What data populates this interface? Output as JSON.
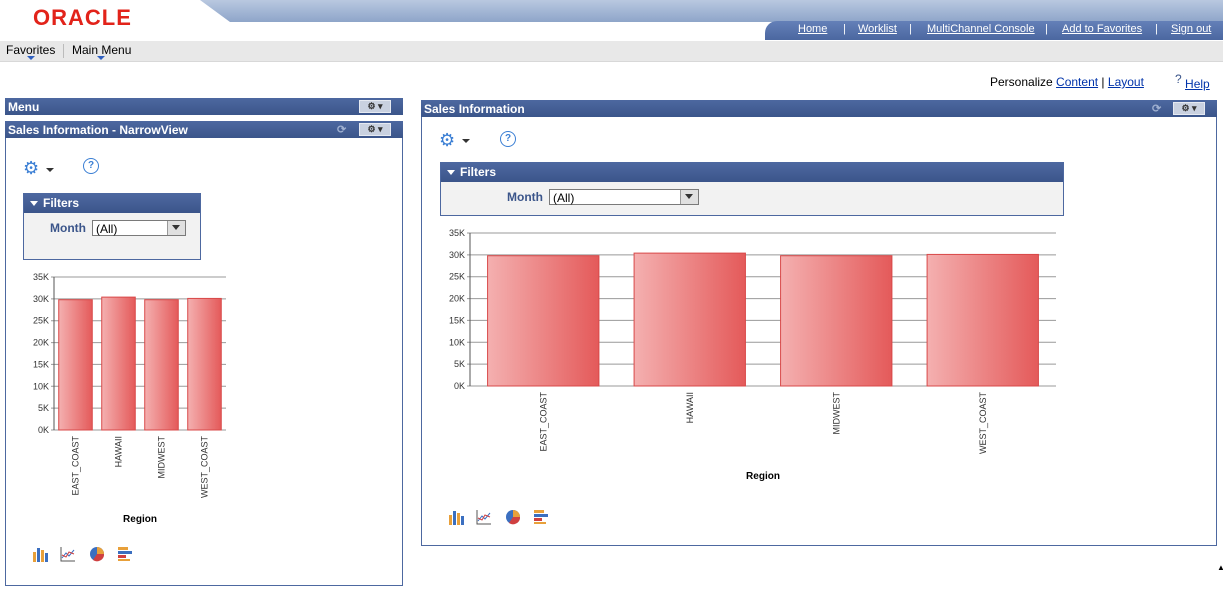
{
  "header": {
    "logo": "ORACLE",
    "links": [
      "Home",
      "Worklist",
      "MultiChannel Console",
      "Add to Favorites",
      "Sign out"
    ]
  },
  "menubar": {
    "favorites": "Favorites",
    "main_menu": "Main Menu"
  },
  "personalize": {
    "label": "Personalize",
    "content": "Content",
    "separator": "|",
    "layout": "Layout"
  },
  "help": {
    "symbol": "?",
    "label": "Help"
  },
  "left": {
    "menu_title": "Menu",
    "panel_title": "Sales Information - NarrowView",
    "filters": {
      "title": "Filters",
      "month_label": "Month",
      "month_value": "(All)"
    }
  },
  "right": {
    "panel_title": "Sales Information",
    "filters": {
      "title": "Filters",
      "month_label": "Month",
      "month_value": "(All)"
    }
  },
  "chart_data": [
    {
      "type": "bar",
      "categories": [
        "EAST_COAST",
        "HAWAII",
        "MIDWEST",
        "WEST_COAST"
      ],
      "values": [
        29800,
        30400,
        29800,
        30100
      ],
      "xlabel": "Region",
      "ylabel": "",
      "ylim": [
        0,
        35000
      ],
      "yticks": [
        "0K",
        "5K",
        "10K",
        "15K",
        "20K",
        "25K",
        "30K",
        "35K"
      ],
      "grid": true,
      "bar_color": "#e45a5a"
    },
    {
      "type": "bar",
      "categories": [
        "EAST_COAST",
        "HAWAII",
        "MIDWEST",
        "WEST_COAST"
      ],
      "values": [
        29800,
        30400,
        29800,
        30100
      ],
      "xlabel": "Region",
      "ylabel": "",
      "ylim": [
        0,
        35000
      ],
      "yticks": [
        "0K",
        "5K",
        "10K",
        "15K",
        "20K",
        "25K",
        "30K",
        "35K"
      ],
      "grid": true,
      "bar_color": "#e45a5a"
    }
  ],
  "chart_type_icons": [
    "bar-chart-icon",
    "line-chart-icon",
    "pie-chart-icon",
    "horizontal-bar-chart-icon"
  ]
}
